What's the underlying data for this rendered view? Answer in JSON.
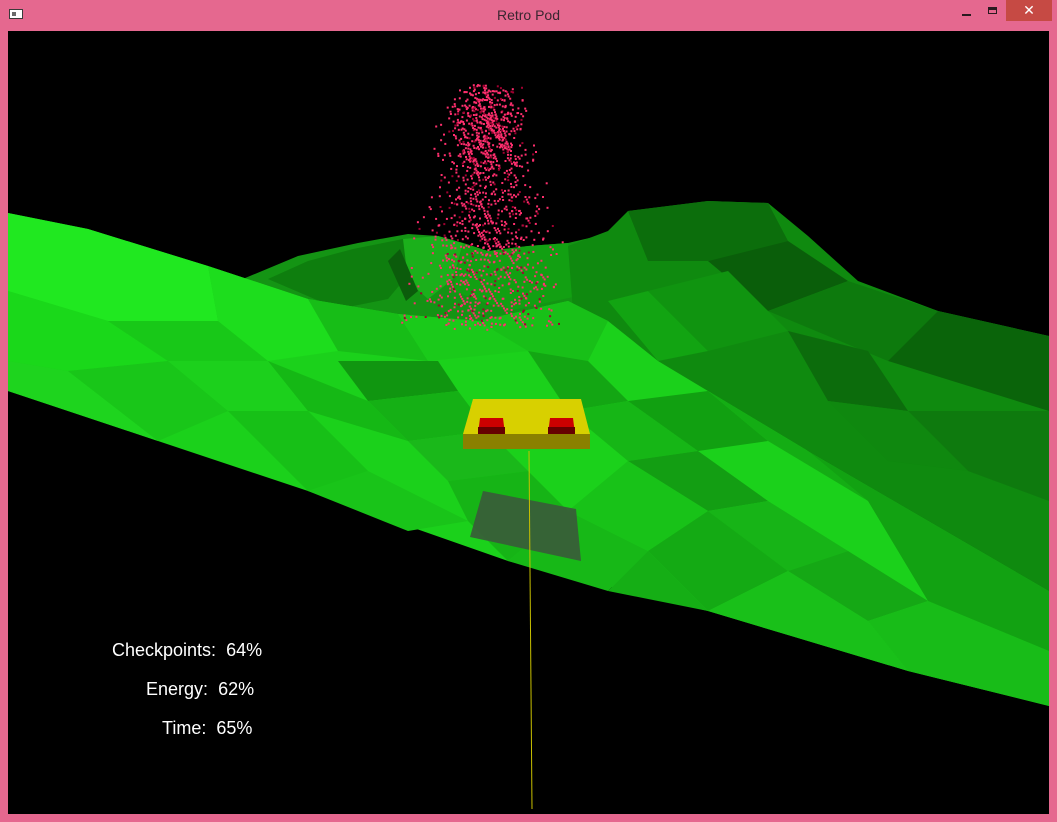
{
  "window": {
    "title": "Retro Pod",
    "close_glyph": "✕"
  },
  "hud": {
    "checkpoints_label": "Checkpoints:",
    "checkpoints_value": "64%",
    "energy_label": "Energy:",
    "energy_value": "62%",
    "time_label": "Time:",
    "time_value": "65%"
  },
  "colors": {
    "frame": "#e5688f",
    "sky": "#000000",
    "terrain_light": "#1fe01f",
    "terrain_mid": "#14c914",
    "terrain_dark": "#0e8a0e",
    "particles": "#ff2f6e",
    "pod_body": "#d8d000",
    "pod_lights": "#cc0000",
    "hud_text": "#ffffff"
  }
}
